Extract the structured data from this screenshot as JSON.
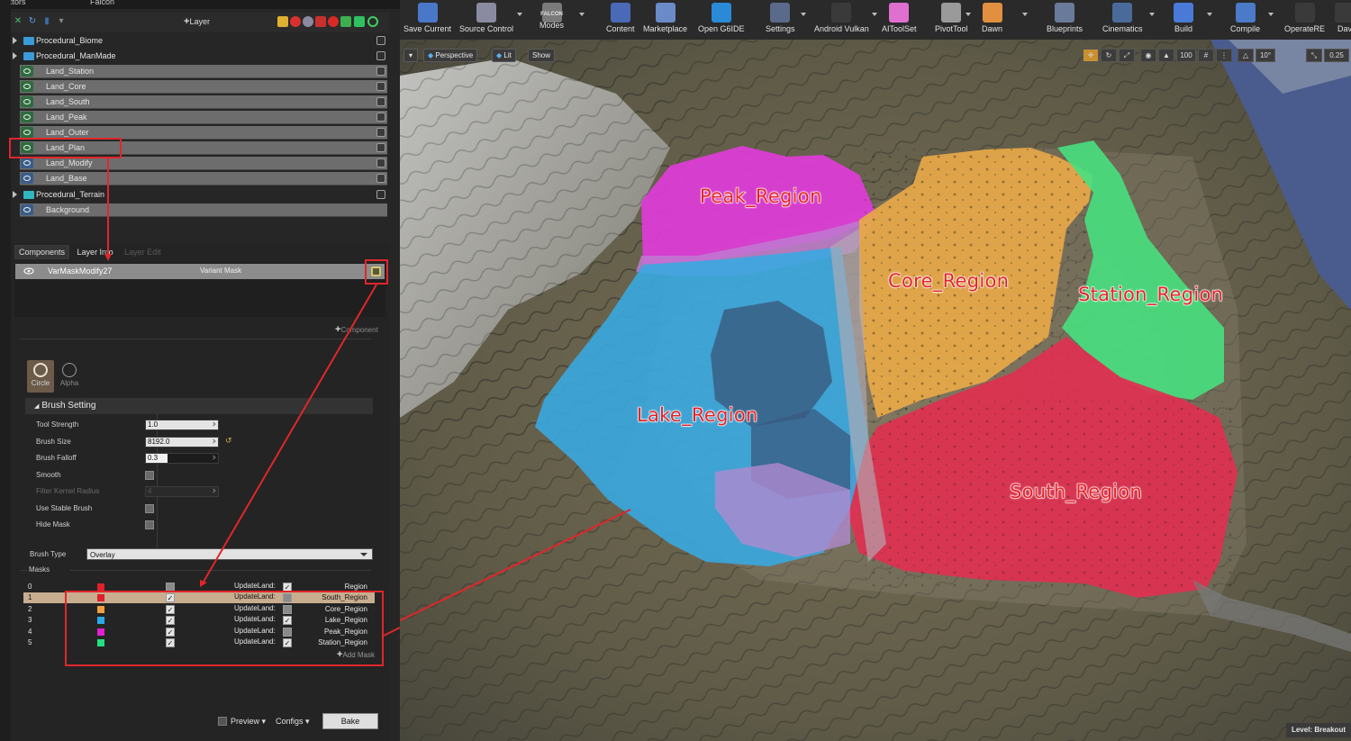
{
  "top_tabs": {
    "actors": "Actors",
    "falcon": "Falcon"
  },
  "layer_toolbar": {
    "add_layer": "Layer"
  },
  "layers": [
    {
      "name": "Procedural_Biome",
      "group": true
    },
    {
      "name": "Procedural_ManMade",
      "group": true
    },
    {
      "name": "Land_Station",
      "group": false
    },
    {
      "name": "Land_Core",
      "group": false
    },
    {
      "name": "Land_South",
      "group": false
    },
    {
      "name": "Land_Peak",
      "group": false
    },
    {
      "name": "Land_Outer",
      "group": false
    },
    {
      "name": "Land_Plan",
      "group": false
    },
    {
      "name": "Land_Modify",
      "group": false
    },
    {
      "name": "Land_Base",
      "group": false
    },
    {
      "name": "Procedural_Terrain",
      "group": true
    },
    {
      "name": "Background",
      "group": false
    }
  ],
  "subtabs": {
    "components": "Components",
    "layer_info": "Layer Info",
    "layer_edit": "Layer Edit"
  },
  "component": {
    "name": "VarMaskModify27",
    "type": "Variant Mask",
    "add_label": "Component"
  },
  "brush_shapes": {
    "circle": "Circle",
    "alpha": "Alpha"
  },
  "brush_setting": {
    "header": "Brush Setting",
    "tool_strength_label": "Tool Strength",
    "tool_strength": "1.0",
    "brush_size_label": "Brush Size",
    "brush_size": "8192.0",
    "brush_falloff_label": "Brush Falloff",
    "brush_falloff": "0.3",
    "brush_falloff_fill": 0.3,
    "smooth_label": "Smooth",
    "filter_kernel_label": "Filter Kernel Radius",
    "filter_kernel": "4",
    "stable_brush_label": "Use Stable Brush",
    "hide_mask_label": "Hide Mask"
  },
  "brush_type": {
    "label": "Brush Type",
    "value": "Overlay"
  },
  "masks": {
    "label": "Masks",
    "add_label": "Add Mask",
    "rows": [
      {
        "index": "0",
        "color": "#e0202a",
        "enabled": false,
        "update_label": "UpdateLand:",
        "update": true,
        "name": "Region"
      },
      {
        "index": "1",
        "color": "#e0202a",
        "enabled": true,
        "update_label": "UpdateLand:",
        "update": false,
        "name": "South_Region"
      },
      {
        "index": "2",
        "color": "#f0a040",
        "enabled": true,
        "update_label": "UpdateLand:",
        "update": false,
        "name": "Core_Region"
      },
      {
        "index": "3",
        "color": "#2aa8e8",
        "enabled": true,
        "update_label": "UpdateLand:",
        "update": true,
        "name": "Lake_Region"
      },
      {
        "index": "4",
        "color": "#e020d0",
        "enabled": true,
        "update_label": "UpdateLand:",
        "update": false,
        "name": "Peak_Region"
      },
      {
        "index": "5",
        "color": "#20e080",
        "enabled": true,
        "update_label": "UpdateLand:",
        "update": true,
        "name": "Station_Region"
      }
    ]
  },
  "bottom": {
    "preview": "Preview",
    "configs": "Configs",
    "bake": "Bake"
  },
  "toolbar": [
    {
      "label": "Save Current",
      "icon": "save-icon"
    },
    {
      "label": "Source Control",
      "icon": "source-control-icon"
    },
    {
      "label": "Modes",
      "sub": "FALCON",
      "icon": "falcon-modes-icon"
    },
    {
      "label": "Content",
      "icon": "content-icon"
    },
    {
      "label": "Marketplace",
      "icon": "marketplace-icon"
    },
    {
      "label": "Open G6IDE",
      "icon": "g6ide-icon"
    },
    {
      "label": "Settings",
      "icon": "settings-icon"
    },
    {
      "label": "Android Vulkan",
      "icon": "android-icon"
    },
    {
      "label": "AIToolSet",
      "icon": "aitoolset-icon"
    },
    {
      "label": "PivotTool",
      "icon": "pivot-icon"
    },
    {
      "label": "Dawn",
      "icon": "dawn-icon"
    },
    {
      "label": "Blueprints",
      "icon": "blueprints-icon"
    },
    {
      "label": "Cinematics",
      "icon": "cinematics-icon"
    },
    {
      "label": "Build",
      "icon": "build-icon"
    },
    {
      "label": "Compile",
      "icon": "compile-icon"
    },
    {
      "label": "OperateRE",
      "icon": "operate-icon"
    },
    {
      "label": "Dav",
      "icon": "dav-icon"
    }
  ],
  "viewport": {
    "perspective": "Perspective",
    "lit": "Lit",
    "show": "Show",
    "grid_size": "100",
    "rot_snap": "10°",
    "scale_snap": "0.25",
    "level": "Level:  Breakout"
  },
  "regions": {
    "peak": "Peak_Region",
    "core": "Core_Region",
    "station": "Station_Region",
    "lake": "Lake_Region",
    "south": "South_Region"
  },
  "colors": {
    "peak": "#e03cd8",
    "core": "#e8a848",
    "station": "#48e080",
    "lake": "#38a8e0",
    "south": "#e03050",
    "annotation": "#e0262b"
  }
}
